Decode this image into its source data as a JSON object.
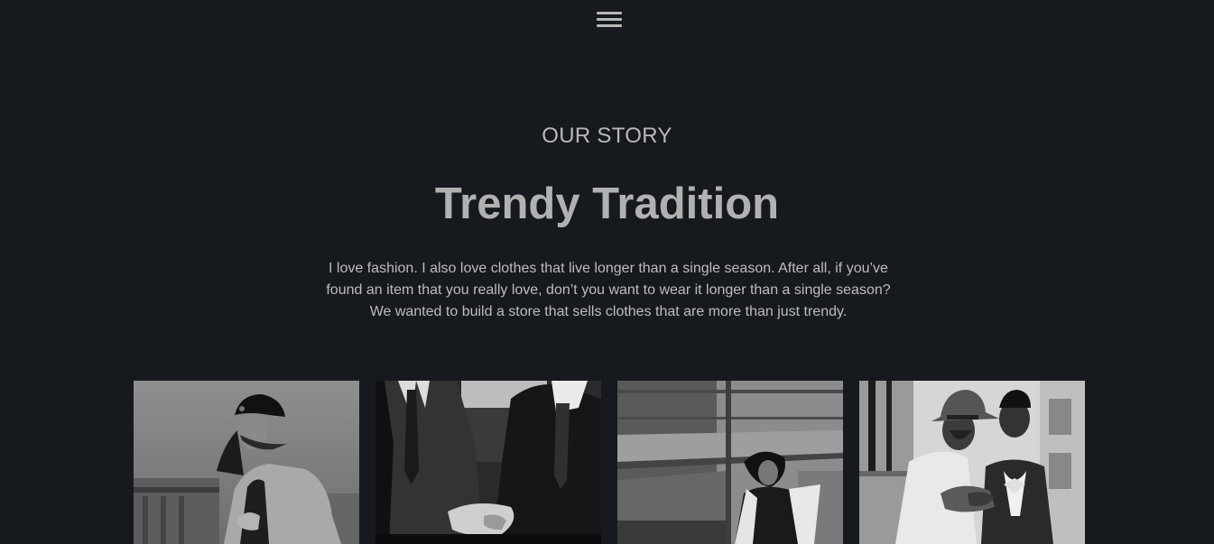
{
  "nav": {
    "menu_icon": "hamburger-menu-icon"
  },
  "story": {
    "eyebrow": "OUR STORY",
    "title": "Trendy Tradition",
    "body": "I love fashion. I also love clothes that live longer than a single season. After all, if you’ve found an item that you really love, don’t you want to wear it longer than a single season? We wanted to build a store that sells clothes that are more than just trendy."
  },
  "gallery": {
    "photos": [
      {
        "subject": "woman-in-cap-and-coat"
      },
      {
        "subject": "men-in-suits"
      },
      {
        "subject": "woman-by-stone-pillar"
      },
      {
        "subject": "two-men-in-hats"
      }
    ]
  },
  "colors": {
    "background": "#16191e",
    "text": "#bdbdbd",
    "heading": "#b1b1b1"
  }
}
